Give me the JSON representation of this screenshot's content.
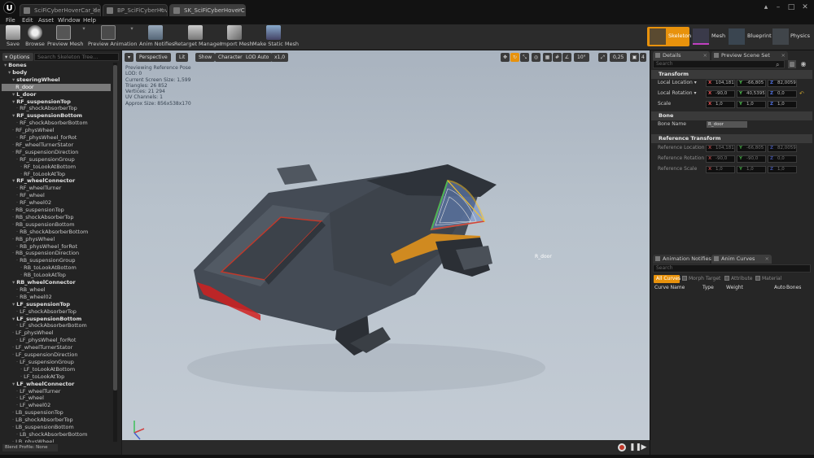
{
  "titlebar": {
    "tabs": [
      {
        "label": "SciFiCyberHoverCar_demole",
        "active": false
      },
      {
        "label": "BP_SciFiCyberHoverCar",
        "active": false
      },
      {
        "label": "SK_SciFiCyberHoverCar",
        "active": true
      }
    ],
    "logo": "U"
  },
  "menu": [
    "File",
    "Edit",
    "Asset",
    "Window",
    "Help"
  ],
  "toolbar": {
    "buttons": [
      "Save",
      "Browse",
      "Preview Mesh",
      "Preview Animation",
      "Anim Notifies",
      "Retarget Manager",
      "Import Mesh",
      "Make Static Mesh"
    ]
  },
  "modes": [
    "Skeleton",
    "Mesh",
    "Blueprint",
    "Physics"
  ],
  "left_panel": {
    "options_label": "Options",
    "search_placeholder": "Search Skeleton Tree...",
    "tree": [
      {
        "label": "Bones",
        "bold": true,
        "depth": 0
      },
      {
        "label": "body",
        "bold": true,
        "depth": 1
      },
      {
        "label": "steeringWheel",
        "bold": true,
        "depth": 2
      },
      {
        "label": "R_door",
        "bold": false,
        "depth": 2,
        "selected": true
      },
      {
        "label": "L_door",
        "bold": true,
        "depth": 2
      },
      {
        "label": "RF_suspensionTop",
        "bold": true,
        "depth": 2
      },
      {
        "label": "RF_shockAbsorberTop",
        "bold": false,
        "depth": 3
      },
      {
        "label": "RF_suspensionBottom",
        "bold": true,
        "depth": 2
      },
      {
        "label": "RF_shockAbsorberBottom",
        "bold": false,
        "depth": 3
      },
      {
        "label": "RF_physWheel",
        "bold": false,
        "depth": 2
      },
      {
        "label": "RF_physWheel_forRot",
        "bold": false,
        "depth": 3
      },
      {
        "label": "RF_wheelTurnerStator",
        "bold": false,
        "depth": 2
      },
      {
        "label": "RF_suspensionDirection",
        "bold": false,
        "depth": 2
      },
      {
        "label": "RF_suspensionGroup",
        "bold": false,
        "depth": 3
      },
      {
        "label": "RF_toLookAtBottom",
        "bold": false,
        "depth": 4
      },
      {
        "label": "RF_toLookAtTop",
        "bold": false,
        "depth": 4
      },
      {
        "label": "RF_wheelConnector",
        "bold": true,
        "depth": 2
      },
      {
        "label": "RF_wheelTurner",
        "bold": false,
        "depth": 3
      },
      {
        "label": "RF_wheel",
        "bold": false,
        "depth": 3
      },
      {
        "label": "RF_wheel02",
        "bold": false,
        "depth": 3
      },
      {
        "label": "RB_suspensionTop",
        "bold": false,
        "depth": 2
      },
      {
        "label": "RB_shockAbsorberTop",
        "bold": false,
        "depth": 2
      },
      {
        "label": "RB_suspensionBottom",
        "bold": false,
        "depth": 2
      },
      {
        "label": "RB_shockAbsorberBottom",
        "bold": false,
        "depth": 3
      },
      {
        "label": "RB_physWheel",
        "bold": false,
        "depth": 2
      },
      {
        "label": "RB_physWheel_forRot",
        "bold": false,
        "depth": 3
      },
      {
        "label": "RB_suspensionDirection",
        "bold": false,
        "depth": 2
      },
      {
        "label": "RB_suspensionGroup",
        "bold": false,
        "depth": 3
      },
      {
        "label": "RB_toLookAtBottom",
        "bold": false,
        "depth": 4
      },
      {
        "label": "RB_toLookAtTop",
        "bold": false,
        "depth": 4
      },
      {
        "label": "RB_wheelConnector",
        "bold": true,
        "depth": 2
      },
      {
        "label": "RB_wheel",
        "bold": false,
        "depth": 3
      },
      {
        "label": "RB_wheel02",
        "bold": false,
        "depth": 3
      },
      {
        "label": "LF_suspensionTop",
        "bold": true,
        "depth": 2
      },
      {
        "label": "LF_shockAbsorberTop",
        "bold": false,
        "depth": 3
      },
      {
        "label": "LF_suspensionBottom",
        "bold": true,
        "depth": 2
      },
      {
        "label": "LF_shockAbsorberBottom",
        "bold": false,
        "depth": 3
      },
      {
        "label": "LF_physWheel",
        "bold": false,
        "depth": 2
      },
      {
        "label": "LF_physWheel_forRot",
        "bold": false,
        "depth": 3
      },
      {
        "label": "LF_wheelTurnerStator",
        "bold": false,
        "depth": 2
      },
      {
        "label": "LF_suspensionDirection",
        "bold": false,
        "depth": 2
      },
      {
        "label": "LF_suspensionGroup",
        "bold": false,
        "depth": 3
      },
      {
        "label": "LF_toLookAtBottom",
        "bold": false,
        "depth": 4
      },
      {
        "label": "LF_toLookAtTop",
        "bold": false,
        "depth": 4
      },
      {
        "label": "LF_wheelConnector",
        "bold": true,
        "depth": 2
      },
      {
        "label": "LF_wheelTurner",
        "bold": false,
        "depth": 3
      },
      {
        "label": "LF_wheel",
        "bold": false,
        "depth": 3
      },
      {
        "label": "LF_wheel02",
        "bold": false,
        "depth": 3
      },
      {
        "label": "LB_suspensionTop",
        "bold": false,
        "depth": 2
      },
      {
        "label": "LB_shockAbsorberTop",
        "bold": false,
        "depth": 2
      },
      {
        "label": "LB_suspensionBottom",
        "bold": false,
        "depth": 2
      },
      {
        "label": "LB_shockAbsorberBottom",
        "bold": false,
        "depth": 3
      },
      {
        "label": "LB_physWheel",
        "bold": false,
        "depth": 2
      }
    ],
    "blend_profile": "Blend Profile: None"
  },
  "viewport": {
    "buttons": {
      "perspective": "Perspective",
      "lit": "Lit",
      "show": "Show",
      "character": "Character",
      "lod": "LOD Auto",
      "speed": "x1,0"
    },
    "right_controls": {
      "fov": "10°",
      "snap": "0,25",
      "cam": "4"
    },
    "stats": [
      "Previewing Reference Pose",
      "LOD: 0",
      "Current Screen Size: 1,599",
      "Triangles: 26 852",
      "Vertices: 21 294",
      "UV Channels: 1",
      "Approx Size: 856x538x170"
    ],
    "bone_label": "R_door"
  },
  "details": {
    "tabs": [
      "Details",
      "Preview Scene Set"
    ],
    "search_placeholder": "Search",
    "transform": {
      "title": "Transform",
      "location": {
        "label": "Local Location",
        "x": "104,181",
        "y": "-66,805",
        "z": "82,0059"
      },
      "rotation": {
        "label": "Local Rotation",
        "x": "-90,0",
        "y": "40,5395",
        "z": "0,0"
      },
      "scale": {
        "label": "Scale",
        "x": "1,0",
        "y": "1,0",
        "z": "1,0"
      }
    },
    "bone": {
      "title": "Bone",
      "name_label": "Bone Name",
      "name_value": "R_door"
    },
    "reference": {
      "title": "Reference Transform",
      "location": {
        "label": "Reference Location",
        "x": "104,181",
        "y": "-66,805",
        "z": "82,0059"
      },
      "rotation": {
        "label": "Reference Rotation",
        "x": "-90,0",
        "y": "-90,0",
        "z": "0,0"
      },
      "scale": {
        "label": "Reference Scale",
        "x": "1,0",
        "y": "1,0",
        "z": "1,0"
      }
    }
  },
  "curves": {
    "tabs": [
      "Animation Notifies",
      "Anim Curves"
    ],
    "search_placeholder": "Search",
    "filters": [
      "All Curves",
      "Morph Target",
      "Attribute",
      "Material"
    ],
    "columns": [
      "Curve Name",
      "Type",
      "Weight",
      "Auto",
      "Bones"
    ]
  },
  "colors": {
    "accent": "#e8920c",
    "selection": "#7a7a7a",
    "door_rim": "#f0c030"
  }
}
